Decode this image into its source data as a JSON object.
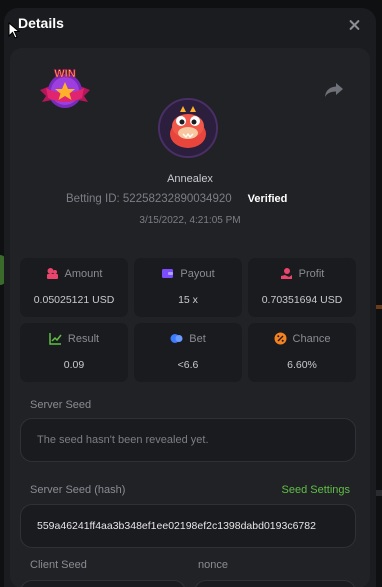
{
  "modal": {
    "title": "Details"
  },
  "badge": {
    "text": "WIN"
  },
  "user": {
    "name": "Annealex",
    "betting_id_label": "Betting ID:",
    "betting_id": "52258232890034920",
    "verified": "Verified",
    "timestamp": "3/15/2022, 4:21:05 PM"
  },
  "stats": [
    {
      "label": "Amount",
      "value": "0.05025121 USD",
      "icon": "money-icon",
      "color": "#e9456d"
    },
    {
      "label": "Payout",
      "value": "15 x",
      "icon": "wallet-icon",
      "color": "#7c4dff"
    },
    {
      "label": "Profit",
      "value": "0.70351694 USD",
      "icon": "profit-icon",
      "color": "#e9456d"
    },
    {
      "label": "Result",
      "value": "0.09",
      "icon": "chart-icon",
      "color": "#5fbf45"
    },
    {
      "label": "Bet",
      "value": "<6.6",
      "icon": "coins-icon",
      "color": "#3d7bff"
    },
    {
      "label": "Chance",
      "value": "6.60%",
      "icon": "percent-icon",
      "color": "#f58220"
    }
  ],
  "server_seed": {
    "label": "Server Seed",
    "value": "The seed hasn't been revealed yet."
  },
  "server_seed_hash": {
    "label": "Server Seed (hash)",
    "settings_link": "Seed Settings",
    "value": "559a46241ff4aa3b348ef1ee02198ef2c1398dabd0193c6782"
  },
  "client_seed": {
    "label": "Client Seed"
  },
  "nonce": {
    "label": "nonce"
  },
  "colors": {
    "accent_green": "#5fbf45",
    "panel": "#212226",
    "card": "#1a1b1e"
  }
}
